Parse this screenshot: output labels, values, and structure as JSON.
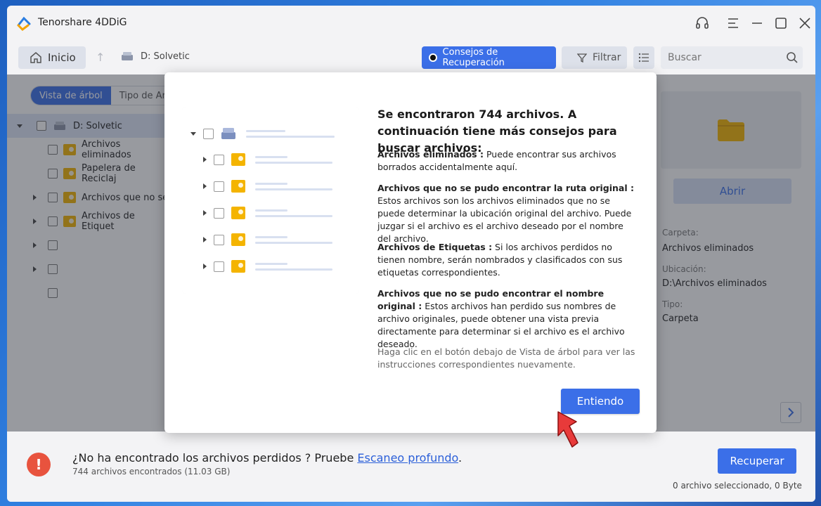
{
  "window": {
    "title": "Tenorshare 4DDiG"
  },
  "toolbar": {
    "home_label": "Inicio",
    "drive_label": "D: Solvetic",
    "tips_label": "Consejos de Recuperación",
    "filter_label": "Filtrar",
    "search_placeholder": "Buscar"
  },
  "tabs": {
    "tree": "Vista de árbol",
    "type": "Tipo de Arc"
  },
  "tree": {
    "root": "D: Solvetic",
    "items": [
      "Archivos eliminados",
      "Papelera de Reciclaj",
      "Archivos que no se",
      "Archivos de Etiquet"
    ]
  },
  "details": {
    "open_label": "Abrir",
    "folder_label": "Carpeta:",
    "folder_value": "Archivos eliminados",
    "location_label": "Ubicación:",
    "location_value": "D:\\Archivos eliminados",
    "type_label": "Tipo:",
    "type_value": "Carpeta"
  },
  "footer": {
    "not_found_prefix": "¿No ha encontrado los archivos perdidos ? Pruebe ",
    "deep_scan_link": "Escaneo profundo",
    "period": ".",
    "files_found": "744 archivos encontrados (11.03 GB)",
    "recover_label": "Recuperar",
    "selected_status": "0 archivo seleccionado, 0 Byte"
  },
  "modal": {
    "heading": "Se encontraron 744 archivos. A continuación tiene más consejos para buscar archivos:",
    "tips": [
      {
        "title": "Archivos eliminados :",
        "text": " Puede encontrar sus archivos borrados accidentalmente aquí."
      },
      {
        "title": "Archivos que no se pudo encontrar la ruta original :",
        "text": " Estos archivos son los archivos eliminados que no se puede determinar la ubicación original del archivo. Puede juzgar si el archivo es el archivo deseado por el nombre del archivo."
      },
      {
        "title": "Archivos de Etiquetas :",
        "text": " Si los archivos perdidos no tienen nombre, serán nombrados y clasificados con sus etiquetas correspondientes."
      },
      {
        "title": "Archivos que no se pudo encontrar el nombre original :",
        "text": " Estos archivos han perdido sus nombres de archivo originales, puede obtener una vista previa directamente para determinar si el archivo es el archivo deseado."
      }
    ],
    "note": "Haga clic en el botón debajo de Vista de árbol para ver las instrucciones correspondientes nuevamente.",
    "button_label": "Entiendo"
  },
  "colors": {
    "accent": "#3b6fe8",
    "warning": "#e8533e",
    "folder": "#f4b400",
    "pointer": "#e83a3a"
  }
}
